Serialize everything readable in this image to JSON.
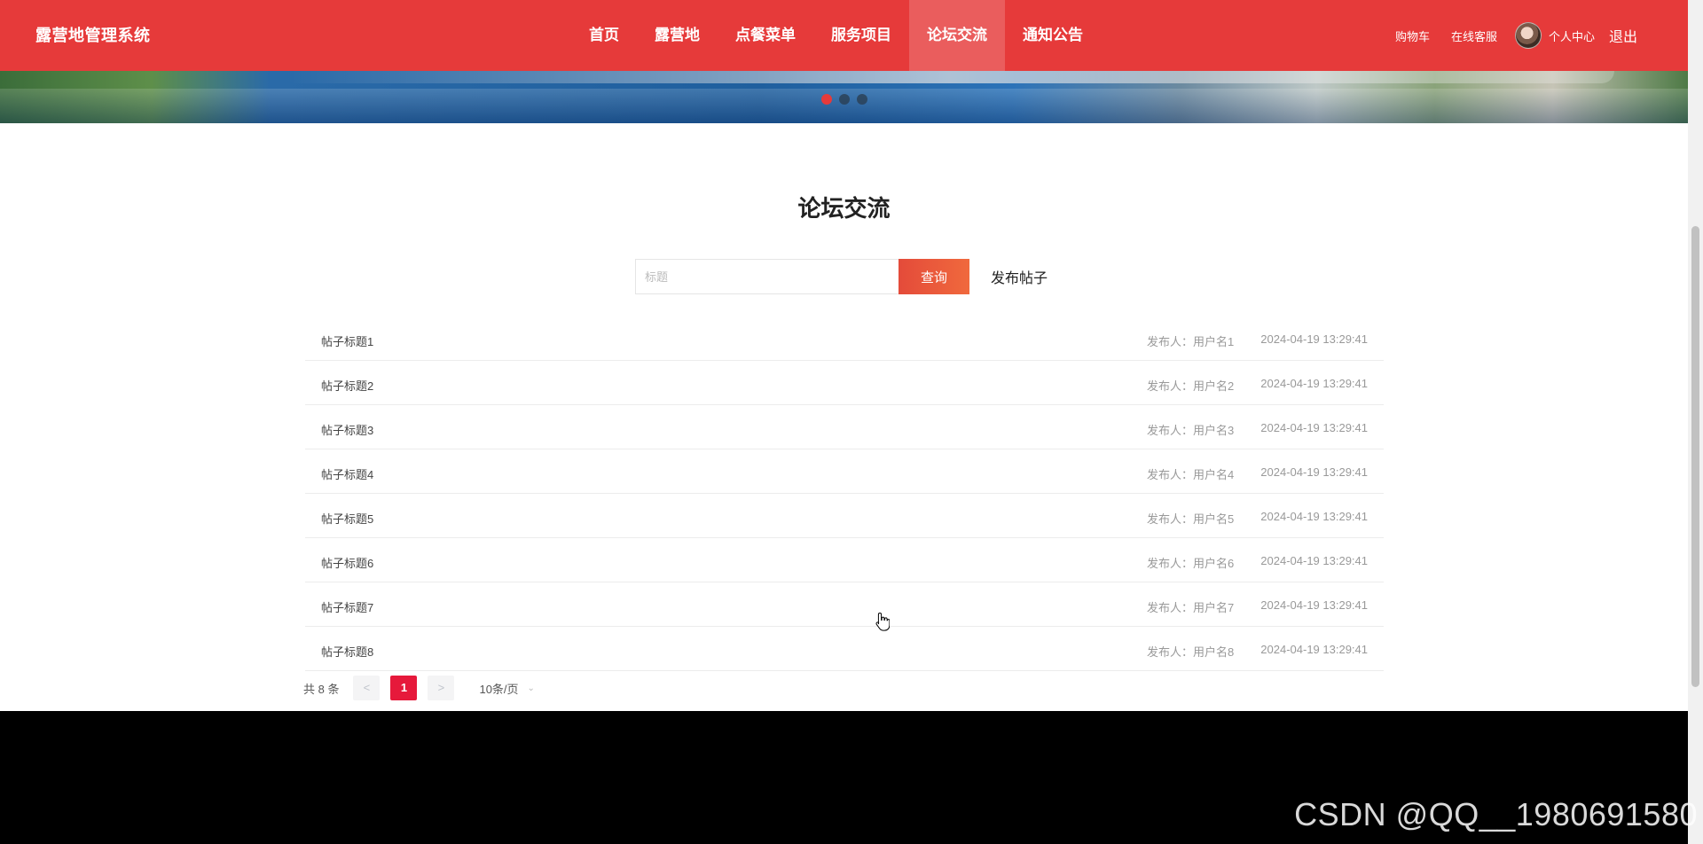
{
  "header": {
    "brand": "露营地管理系统",
    "nav": [
      {
        "label": "首页"
      },
      {
        "label": "露营地"
      },
      {
        "label": "点餐菜单"
      },
      {
        "label": "服务项目"
      },
      {
        "label": "论坛交流",
        "active": true
      },
      {
        "label": "通知公告"
      }
    ],
    "cart": "购物车",
    "service": "在线客服",
    "profile": "个人中心",
    "logout": "退出"
  },
  "banner": {
    "slides": 3,
    "active_slide": 1
  },
  "main": {
    "title": "论坛交流",
    "search": {
      "placeholder": "标题",
      "value": "",
      "button": "查询"
    },
    "publish": "发布帖子",
    "posts": [
      {
        "title": "帖子标题1",
        "author": "发布人：用户名1",
        "time": "2024-04-19 13:29:41"
      },
      {
        "title": "帖子标题2",
        "author": "发布人：用户名2",
        "time": "2024-04-19 13:29:41"
      },
      {
        "title": "帖子标题3",
        "author": "发布人：用户名3",
        "time": "2024-04-19 13:29:41"
      },
      {
        "title": "帖子标题4",
        "author": "发布人：用户名4",
        "time": "2024-04-19 13:29:41"
      },
      {
        "title": "帖子标题5",
        "author": "发布人：用户名5",
        "time": "2024-04-19 13:29:41"
      },
      {
        "title": "帖子标题6",
        "author": "发布人：用户名6",
        "time": "2024-04-19 13:29:41"
      },
      {
        "title": "帖子标题7",
        "author": "发布人：用户名7",
        "time": "2024-04-19 13:29:41"
      },
      {
        "title": "帖子标题8",
        "author": "发布人：用户名8",
        "time": "2024-04-19 13:29:41"
      }
    ],
    "pagination": {
      "total": "共 8 条",
      "prev": "<",
      "current": "1",
      "next": ">",
      "page_size": "10条/页"
    }
  },
  "watermark": "CSDN @QQ__1980691580",
  "colors": {
    "header": "#e63a3a",
    "accent": "#e6193b",
    "footer": "#000000"
  }
}
